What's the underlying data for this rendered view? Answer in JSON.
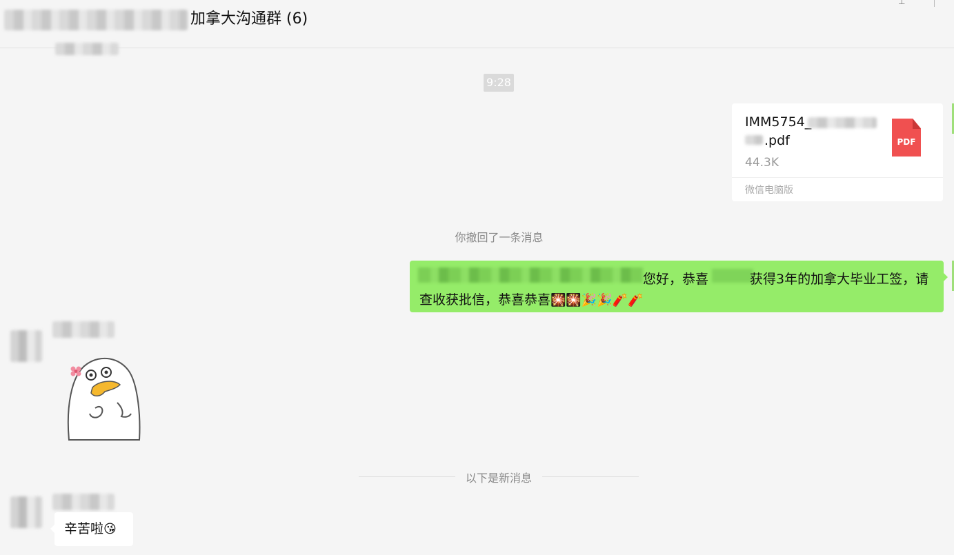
{
  "header": {
    "title": "加拿大沟通群 (6)",
    "pin_icon": "pin-icon"
  },
  "messages": {
    "time": "9:28",
    "file": {
      "name_prefix": "IMM5754_",
      "name_suffix": ".pdf",
      "size": "44.3K",
      "source": "微信电脑版",
      "icon_label": "PDF"
    },
    "recall_notice": "你撤回了一条消息",
    "congrats": {
      "part1": "您好，恭喜",
      "part2": "获得3年的加拿大毕业工签，请",
      "line2": "查收获批信，恭喜恭喜",
      "emojis": "🎇🎇🎉🎉🧨🧨"
    },
    "new_divider": "以下是新消息",
    "reply": {
      "text": "辛苦啦",
      "emoji": "😘"
    }
  },
  "colors": {
    "green_bubble": "#95ec69",
    "white_bubble": "#ffffff",
    "pdf_red": "#f05050"
  }
}
